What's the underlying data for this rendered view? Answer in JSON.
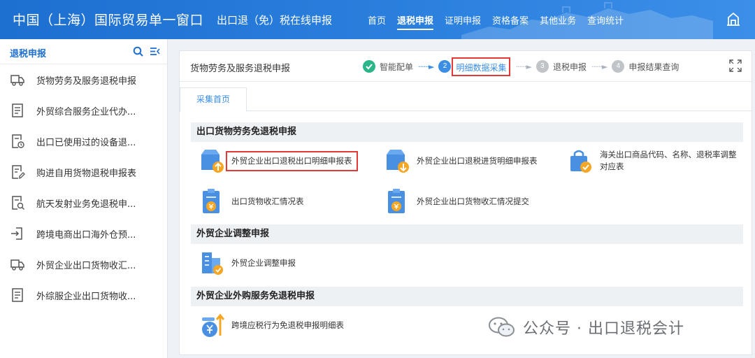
{
  "header": {
    "brand_title": "中国（上海）国际贸易单一窗口",
    "brand_sub": "出口退（免）税在线申报",
    "nav": [
      "首页",
      "退税申报",
      "证明申报",
      "资格备案",
      "其他业务",
      "查询统计"
    ],
    "active_nav": 1
  },
  "sidebar": {
    "title": "退税申报",
    "items": [
      {
        "label": "货物劳务及服务退税申报",
        "icon": "truck-icon"
      },
      {
        "label": "外贸综合服务企业代办...",
        "icon": "document-icon"
      },
      {
        "label": "出口已使用过的设备退...",
        "icon": "document-clock-icon"
      },
      {
        "label": "购进自用货物退税申报表",
        "icon": "document-edit-icon"
      },
      {
        "label": "航天发射业务免退税申...",
        "icon": "document-search-icon"
      },
      {
        "label": "跨境电商出口海外仓预...",
        "icon": "export-icon"
      },
      {
        "label": "外贸企业出口货物收汇...",
        "icon": "truck-icon"
      },
      {
        "label": "外综服企业出口货物收...",
        "icon": "document-icon"
      }
    ]
  },
  "main": {
    "title": "货物劳务及服务退税申报",
    "steps": [
      {
        "num": "",
        "label": "智能配单",
        "state": "done"
      },
      {
        "num": "2",
        "label": "明细数据采集",
        "state": "current"
      },
      {
        "num": "3",
        "label": "退税申报",
        "state": "todo"
      },
      {
        "num": "4",
        "label": "申报结果查询",
        "state": "todo"
      }
    ],
    "tab": "采集首页",
    "sections": [
      {
        "title": "出口货物劳务免退税申报",
        "entries": [
          {
            "label": "外贸企业出口退税出口明细申报表",
            "icon": "box-upload-icon"
          },
          {
            "label": "外贸企业出口退税进货明细申报表",
            "icon": "box-download-icon"
          },
          {
            "label": "海关出口商品代码、名称、退税率调整对应表",
            "icon": "shopping-bag-check-icon"
          },
          {
            "label": "出口货物收汇情况表",
            "icon": "clipboard-yen-icon"
          },
          {
            "label": "外贸企业出口货物收汇情况提交",
            "icon": "clipboard-yen-icon"
          }
        ]
      },
      {
        "title": "外贸企业调整申报",
        "entries": [
          {
            "label": "外贸企业调整申报",
            "icon": "building-check-icon"
          }
        ]
      },
      {
        "title": "外贸企业外购服务免退税申报",
        "entries": [
          {
            "label": "跨境应税行为免退税申报明细表",
            "icon": "coin-yen-up-icon"
          }
        ]
      }
    ]
  },
  "watermark": "公众号 · 出口退税会计",
  "colors": {
    "header": "#2b80de",
    "accent": "#3a8ee6",
    "highlight": "#e53935",
    "step_done": "#2bb58a",
    "icon_blue": "#4a90e2",
    "icon_orange": "#f5a623"
  }
}
